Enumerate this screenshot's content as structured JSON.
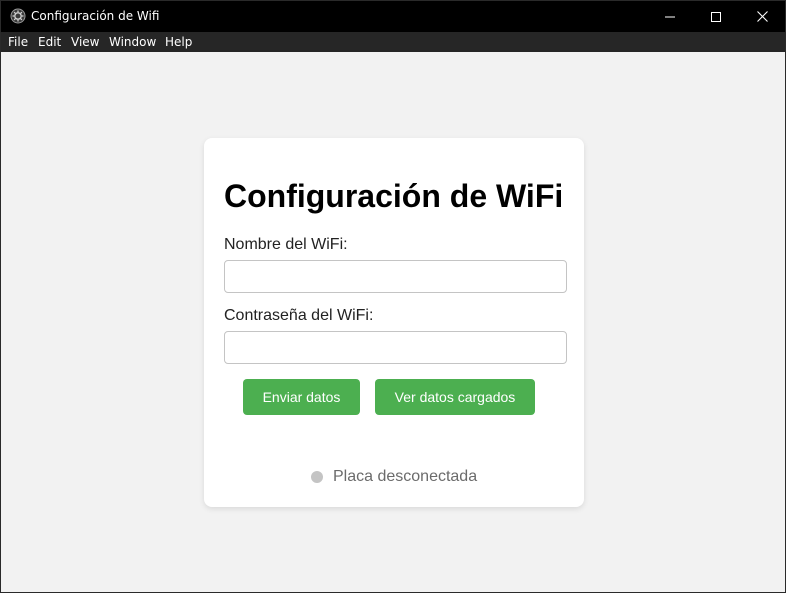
{
  "window": {
    "title": "Configuración de Wifi",
    "icon": "app-gear-icon"
  },
  "menubar": {
    "items": [
      "File",
      "Edit",
      "View",
      "Window",
      "Help"
    ]
  },
  "form": {
    "title": "Configuración de WiFi",
    "ssid_label": "Nombre del WiFi:",
    "ssid_value": "",
    "password_label": "Contraseña del WiFi:",
    "password_value": "",
    "send_button": "Enviar datos",
    "view_button": "Ver datos cargados"
  },
  "status": {
    "text": "Placa desconectada",
    "dot_color": "#c4c4c4"
  },
  "colors": {
    "accent": "#4caf50",
    "titlebar": "#000000",
    "menubar": "#262626",
    "background": "#f2f2f2"
  }
}
